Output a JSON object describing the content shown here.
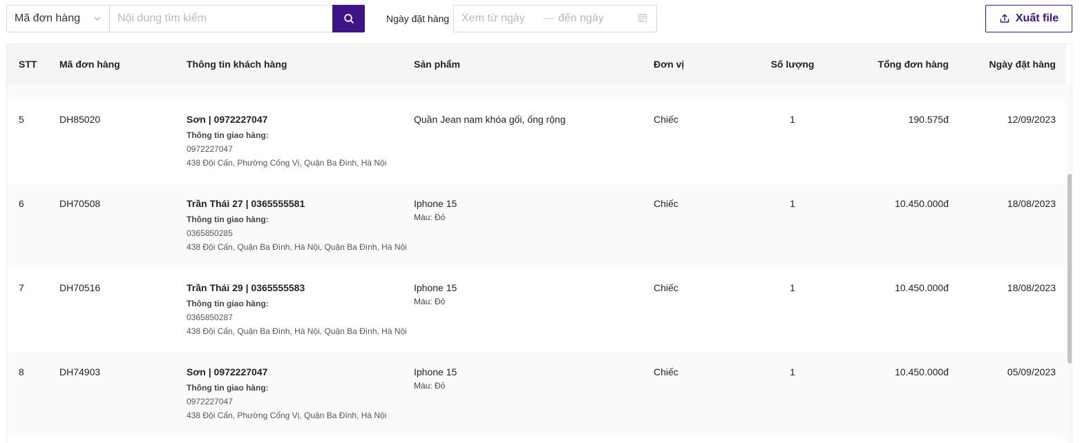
{
  "toolbar": {
    "field_select": "Mã đơn hàng",
    "search_placeholder": "Nội dung tìm kiếm",
    "date_label": "Ngày đặt hàng",
    "date_from_placeholder": "Xem từ ngày",
    "date_separator": "—",
    "date_to_placeholder": "đến ngày",
    "export_label": "Xuất file"
  },
  "colors": {
    "accent": "#3f1489",
    "header_bg": "#f5f5f5",
    "row_alt_bg": "#fafafa"
  },
  "icons": {
    "select": "chevron-down-icon",
    "search": "search-icon",
    "date": "calendar-icon",
    "export": "upload-icon"
  },
  "table": {
    "columns": [
      "STT",
      "Mã đơn hàng",
      "Thông tin khách hàng",
      "Sản phẩm",
      "Đơn vị",
      "Số lượng",
      "Tổng đơn hàng",
      "Ngày đặt hàng"
    ],
    "delivery_label": "Thông tin giao hàng:",
    "rows": [
      {
        "stt": "5",
        "code": "DH85020",
        "customer": "Sơn | 0972227047",
        "phone": "0972227047",
        "address": "438 Đội Cấn, Phường Cống Vị, Quận Ba Đình, Hà Nội",
        "product": "Quần Jean nam khóa gối, ống rộng",
        "variant": "",
        "unit": "Chiếc",
        "qty": "1",
        "total": "190.575đ",
        "date": "12/09/2023"
      },
      {
        "stt": "6",
        "code": "DH70508",
        "customer": "Trần Thái 27 | 0365555581",
        "phone": "0365850285",
        "address": "438 Đội Cấn, Quận Ba Đình, Hà Nội, Quận Ba Đình, Hà Nội",
        "product": "Iphone 15",
        "variant": "Màu: Đỏ",
        "unit": "Chiếc",
        "qty": "1",
        "total": "10.450.000đ",
        "date": "18/08/2023"
      },
      {
        "stt": "7",
        "code": "DH70516",
        "customer": "Trần Thái 29 | 0365555583",
        "phone": "0365850287",
        "address": "438 Đội Cấn, Quận Ba Đình, Hà Nội, Quận Ba Đình, Hà Nội",
        "product": "Iphone 15",
        "variant": "Màu: Đỏ",
        "unit": "Chiếc",
        "qty": "1",
        "total": "10.450.000đ",
        "date": "18/08/2023"
      },
      {
        "stt": "8",
        "code": "DH74903",
        "customer": "Sơn | 0972227047",
        "phone": "0972227047",
        "address": "438 Đội Cấn, Phường Cống Vị, Quận Ba Đình, Hà Nội",
        "product": "Iphone 15",
        "variant": "Màu: Đỏ",
        "unit": "Chiếc",
        "qty": "1",
        "total": "10.450.000đ",
        "date": "05/09/2023"
      }
    ]
  }
}
